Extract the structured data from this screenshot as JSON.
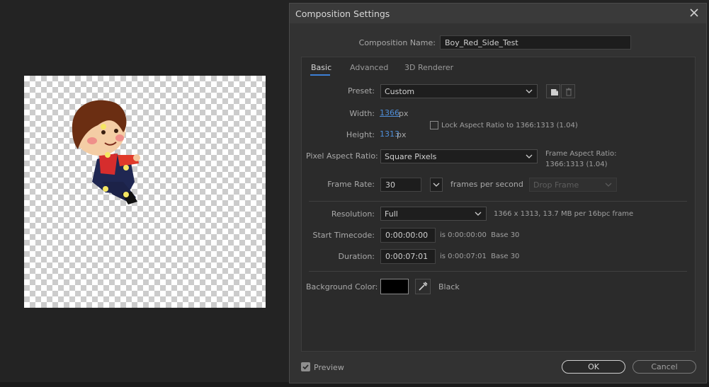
{
  "dialog": {
    "title": "Composition Settings",
    "name_label": "Composition Name:",
    "name_value": "Boy_Red_Side_Test"
  },
  "tabs": [
    {
      "label": "Basic",
      "active": true
    },
    {
      "label": "Advanced",
      "active": false
    },
    {
      "label": "3D Renderer",
      "active": false
    }
  ],
  "basic": {
    "preset_label": "Preset:",
    "preset_value": "Custom",
    "width_label": "Width:",
    "width_value": "1366",
    "height_label": "Height:",
    "height_value": "1313",
    "unit": "px",
    "lock_label": "Lock Aspect Ratio to 1366:1313 (1.04)",
    "lock_checked": false,
    "par_label": "Pixel Aspect Ratio:",
    "par_value": "Square Pixels",
    "far_label": "Frame Aspect Ratio:",
    "far_value": "1366:1313 (1.04)",
    "fps_label": "Frame Rate:",
    "fps_value": "30",
    "fps_unit": "frames per second",
    "drop_frame": "Drop Frame",
    "res_label": "Resolution:",
    "res_value": "Full",
    "res_info": "1366 x 1313, 13.7 MB per 16bpc frame",
    "start_label": "Start Timecode:",
    "start_value": "0:00:00:00",
    "start_info": "is 0:00:00:00  Base 30",
    "dur_label": "Duration:",
    "dur_value": "0:00:07:01",
    "dur_info": "is 0:00:07:01  Base 30",
    "bg_label": "Background Color:",
    "bg_value": "Black",
    "bg_color": "#000000"
  },
  "footer": {
    "preview_label": "Preview",
    "preview_checked": true,
    "ok_label": "OK",
    "cancel_label": "Cancel"
  },
  "colors": {
    "accent": "#3c7fd6",
    "link": "#4f8fd9",
    "dialog_bg": "#323232",
    "panel_bg": "#2b2b2b"
  }
}
